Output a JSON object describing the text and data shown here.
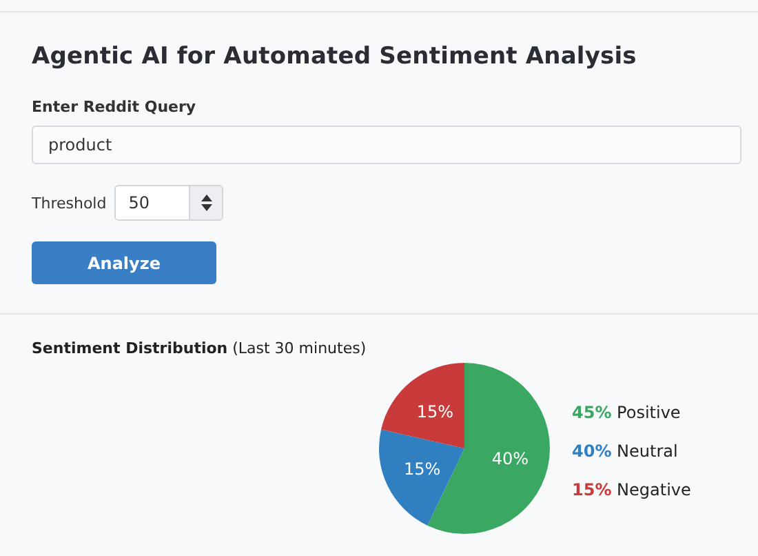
{
  "title": "Agentic AI for Automated Sentiment Analysis",
  "query": {
    "label": "Enter Reddit Query",
    "value": "product"
  },
  "threshold": {
    "label": "Threshold",
    "value": "50"
  },
  "analyze_button": "Analyze",
  "section": {
    "title": "Sentiment Distribution",
    "subtitle": "(Last 30 minutes)"
  },
  "chart_data": {
    "type": "pie",
    "categories": [
      "Positive",
      "Neutral",
      "Negative"
    ],
    "values": [
      40,
      15,
      15
    ],
    "value_labels": [
      "40%",
      "15%",
      "15%"
    ]
  },
  "legend": [
    {
      "percent": "45%",
      "color": "#3aa862"
    },
    {
      "percent": "40%",
      "color": "#2f7fc1"
    },
    {
      "percent": "15%",
      "color": "#c93b3b"
    }
  ]
}
